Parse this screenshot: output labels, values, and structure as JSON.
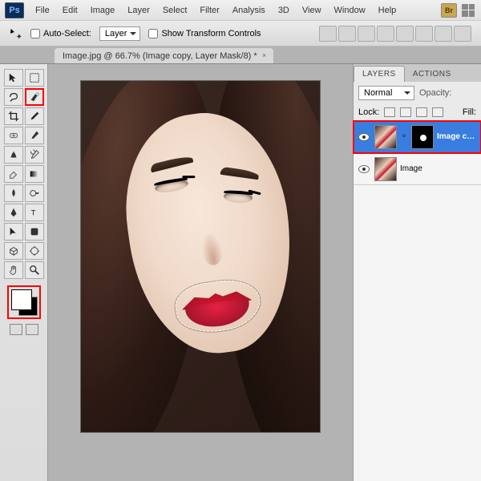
{
  "app": {
    "logo": "Ps",
    "bridgeIcon": "Br"
  },
  "menu": {
    "items": [
      "File",
      "Edit",
      "Image",
      "Layer",
      "Select",
      "Filter",
      "Analysis",
      "3D",
      "View",
      "Window",
      "Help"
    ]
  },
  "optionsBar": {
    "autoSelectLabel": "Auto-Select:",
    "autoSelectChecked": false,
    "layerDropdown": "Layer",
    "showTransformLabel": "Show Transform Controls",
    "showTransformChecked": false
  },
  "documentTab": {
    "title": "Image.jpg @ 66.7% (Image copy, Layer Mask/8) *"
  },
  "tools": {
    "names": [
      "move-tool",
      "marquee-rect-tool",
      "lasso-tool",
      "quick-selection-tool",
      "crop-tool",
      "eyedropper-tool",
      "healing-brush-tool",
      "brush-tool",
      "clone-stamp-tool",
      "history-brush-tool",
      "eraser-tool",
      "gradient-tool",
      "blur-tool",
      "dodge-tool",
      "pen-tool",
      "type-tool",
      "path-selection-tool",
      "shape-tool",
      "3d-tool",
      "hand-tool",
      "hand-tool-2",
      "zoom-tool"
    ],
    "highlighted": "quick-selection-tool"
  },
  "colors": {
    "foreground": "#ffffff",
    "background": "#000000"
  },
  "panels": {
    "tabs": [
      "LAYERS",
      "ACTIONS"
    ],
    "activeTab": "LAYERS",
    "blendMode": "Normal",
    "opacityLabel": "Opacity:",
    "lockLabel": "Lock:",
    "fillLabel": "Fill:",
    "layers": [
      {
        "name": "Image copy",
        "visible": true,
        "hasMask": true,
        "active": true
      },
      {
        "name": "Image",
        "visible": true,
        "hasMask": false,
        "active": false
      }
    ]
  }
}
